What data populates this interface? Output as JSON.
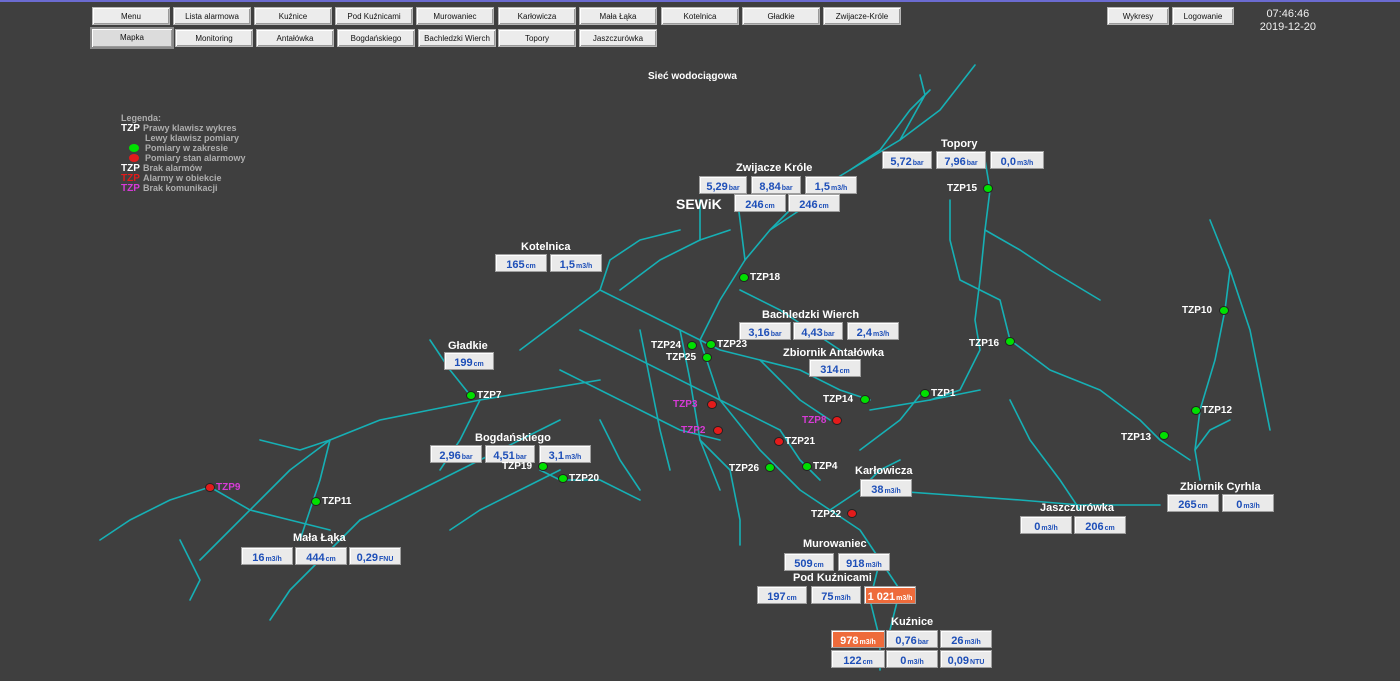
{
  "nav": {
    "row1": [
      "Menu",
      "Lista alarmowa",
      "Kuźnice",
      "Pod Kuźnicami",
      "Murowaniec",
      "Karłowicza",
      "Mała Łąka",
      "Kotelnica",
      "Gładkie",
      "Zwijacze-Króle"
    ],
    "row2": [
      "Mapka",
      "Monitoring",
      "Antałówka",
      "Bogdańskiego",
      "Bachledzki Wierch",
      "Topory",
      "Jaszczurówka"
    ],
    "right": [
      "Wykresy",
      "Logowanie"
    ]
  },
  "clock": {
    "time": "07:46:46",
    "date": "2019-12-20"
  },
  "map_title": "Sieć wodociągowa",
  "logo": "SEWiK",
  "legend": {
    "title": "Legenda:",
    "line1_tag": "TZP",
    "line1": "Prawy klawisz wykres",
    "line2": "Lewy klawisz pomiary",
    "line3": "Pomiary w zakresie",
    "line4": "Pomiary stan alarmowy",
    "line5_tag": "TZP",
    "line5": "Brak alarmów",
    "line6_tag": "TZP",
    "line6": "Alarmy w obiekcie",
    "line7_tag": "TZP",
    "line7": "Brak komunikacji"
  },
  "colors": {
    "pipe": "#16b0b5",
    "ok": "#00e000",
    "alarm": "#e31b1b",
    "nocomm": "#d63bd6",
    "value": "#1e4fb8",
    "alarm_box": "#ee6b3b"
  },
  "stations": {
    "zwijacze": {
      "name": "Zwijacze Króle",
      "b1": {
        "v": "5,29",
        "u": "bar"
      },
      "b2": {
        "v": "8,84",
        "u": "bar"
      },
      "b3": {
        "v": "1,5",
        "u": "m3/h"
      },
      "b4": {
        "v": "246",
        "u": "cm"
      },
      "b5": {
        "v": "246",
        "u": "cm"
      }
    },
    "topory": {
      "name": "Topory",
      "b1": {
        "v": "5,72",
        "u": "bar"
      },
      "b2": {
        "v": "7,96",
        "u": "bar"
      },
      "b3": {
        "v": "0,0",
        "u": "m3/h"
      }
    },
    "kotelnica": {
      "name": "Kotelnica",
      "b1": {
        "v": "165",
        "u": "cm"
      },
      "b2": {
        "v": "1,5",
        "u": "m3/h"
      }
    },
    "bachledzki": {
      "name": "Bachledzki Wierch",
      "b1": {
        "v": "3,16",
        "u": "bar"
      },
      "b2": {
        "v": "4,43",
        "u": "bar"
      },
      "b3": {
        "v": "2,4",
        "u": "m3/h"
      }
    },
    "antalowka": {
      "name": "Zbiornik Antałówka",
      "b1": {
        "v": "314",
        "u": "cm"
      }
    },
    "gladkie": {
      "name": "Gładkie",
      "b1": {
        "v": "199",
        "u": "cm"
      }
    },
    "bogdanskiego": {
      "name": "Bogdańskiego",
      "b1": {
        "v": "2,96",
        "u": "bar"
      },
      "b2": {
        "v": "4,51",
        "u": "bar"
      },
      "b3": {
        "v": "3,1",
        "u": "m3/h"
      }
    },
    "karlowicza": {
      "name": "Karłowicza",
      "b1": {
        "v": "38",
        "u": "m3/h"
      }
    },
    "jaszczurowka": {
      "name": "Jaszczurówka",
      "b1": {
        "v": "0",
        "u": "m3/h"
      },
      "b2": {
        "v": "206",
        "u": "cm"
      }
    },
    "cyrhla": {
      "name": "Zbiornik Cyrhla",
      "b1": {
        "v": "265",
        "u": "cm"
      },
      "b2": {
        "v": "0",
        "u": "m3/h"
      }
    },
    "malalaka": {
      "name": "Mała Łąka",
      "b1": {
        "v": "16",
        "u": "m3/h"
      },
      "b2": {
        "v": "444",
        "u": "cm"
      },
      "b3": {
        "v": "0,29",
        "u": "FNU"
      }
    },
    "murowaniec": {
      "name": "Murowaniec",
      "b1": {
        "v": "509",
        "u": "cm"
      },
      "b2": {
        "v": "918",
        "u": "m3/h"
      }
    },
    "podkuznicami": {
      "name": "Pod Kuźnicami",
      "b1": {
        "v": "197",
        "u": "cm"
      },
      "b2": {
        "v": "75",
        "u": "m3/h"
      },
      "b3": {
        "v": "1 021",
        "u": "m3/h"
      }
    },
    "kuznice": {
      "name": "Kuźnice",
      "b1": {
        "v": "978",
        "u": "m3/h"
      },
      "b2": {
        "v": "0,76",
        "u": "bar"
      },
      "b3": {
        "v": "26",
        "u": "m3/h"
      },
      "b4": {
        "v": "122",
        "u": "cm"
      },
      "b5": {
        "v": "0",
        "u": "m3/h"
      },
      "b6": {
        "v": "0,09",
        "u": "NTU"
      }
    }
  },
  "tzp": [
    {
      "label": "TZP15",
      "status": "ok"
    },
    {
      "label": "TZP18",
      "status": "ok"
    },
    {
      "label": "TZP24",
      "status": "ok"
    },
    {
      "label": "TZP23",
      "status": "ok"
    },
    {
      "label": "TZP25",
      "status": "ok"
    },
    {
      "label": "TZP16",
      "status": "ok"
    },
    {
      "label": "TZP10",
      "status": "ok"
    },
    {
      "label": "TZP7",
      "status": "ok"
    },
    {
      "label": "TZP3",
      "status": "nocomm"
    },
    {
      "label": "TZP2",
      "status": "nocomm"
    },
    {
      "label": "TZP8",
      "status": "nocomm"
    },
    {
      "label": "TZP14",
      "status": "ok"
    },
    {
      "label": "TZP1",
      "status": "ok"
    },
    {
      "label": "TZP12",
      "status": "ok"
    },
    {
      "label": "TZP13",
      "status": "ok"
    },
    {
      "label": "TZP21",
      "status": "alarm"
    },
    {
      "label": "TZP19",
      "status": "ok"
    },
    {
      "label": "TZP20",
      "status": "ok"
    },
    {
      "label": "TZP26",
      "status": "ok"
    },
    {
      "label": "TZP4",
      "status": "ok"
    },
    {
      "label": "TZP9",
      "status": "nocomm"
    },
    {
      "label": "TZP11",
      "status": "ok"
    },
    {
      "label": "TZP22",
      "status": "alarm"
    }
  ]
}
